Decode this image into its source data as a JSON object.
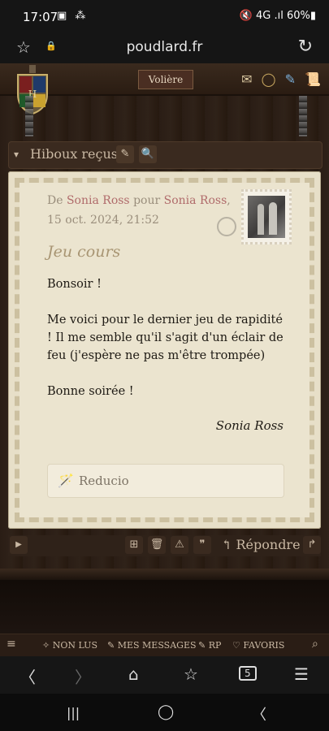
{
  "status_bar": {
    "time": "17:07",
    "icons": "▣ ⁂",
    "right": "🔇 4G .ıl 60%▮"
  },
  "browser": {
    "url": "poudlard.fr",
    "star_icon": "☆",
    "lock_icon": "🔒",
    "reload_icon": "↻"
  },
  "header": {
    "voliere_label": "Volière",
    "icons": [
      "✉",
      "◯",
      "✎",
      "📜"
    ]
  },
  "toolbar": {
    "caret": "▾",
    "title": "Hiboux reçus",
    "edit_icon": "✎",
    "search_icon": "🔍"
  },
  "letter": {
    "from_prefix": "De ",
    "from_name": "Sonia Ross",
    "to_prefix": " pour ",
    "to_name": "Sonia Ross",
    "to_suffix": ",",
    "date": "15 oct. 2024, 21:52",
    "subject": "Jeu cours",
    "paragraphs": [
      "Bonsoir !",
      "Me voici pour le dernier jeu de rapidité ! Il me semble qu'il s'agit d'un éclair de feu (j'espère ne pas m'être trompée)",
      "Bonne soirée !"
    ],
    "signature": "Sonia Ross",
    "reducio_icon": "🪄",
    "reducio_label": "Reducio"
  },
  "actions": {
    "play": "▶",
    "folder": "⊞",
    "trash": "🗑",
    "warn": "⚠",
    "quote": "❞",
    "reply_label": "↰ Répondre",
    "forward": "↱"
  },
  "forum_nav": {
    "menu_icon": "≡",
    "items": [
      "✧ NON LUS",
      "✎ MES MESSAGES",
      "✎ RP",
      "♡ FAVORIS"
    ],
    "search_icon": "⌕"
  },
  "browser_nav": {
    "back": "〈",
    "forward": "〉",
    "home": "⌂",
    "bookmarks": "☆",
    "tabs": "5",
    "menu": "☰"
  },
  "system_nav": {
    "recents": "|||",
    "home": "◯",
    "back": "〈"
  }
}
